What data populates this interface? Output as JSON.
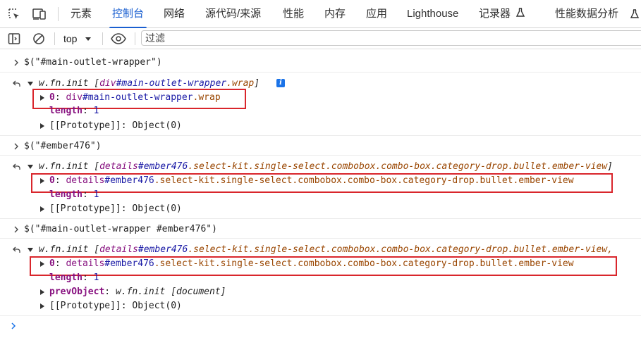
{
  "tabs": [
    {
      "label": "元素"
    },
    {
      "label": "控制台"
    },
    {
      "label": "网络"
    },
    {
      "label": "源代码/来源"
    },
    {
      "label": "性能"
    },
    {
      "label": "内存"
    },
    {
      "label": "应用"
    },
    {
      "label": "Lighthouse"
    },
    {
      "label": "记录器"
    },
    {
      "label": "性能数据分析"
    }
  ],
  "active_tab": "控制台",
  "toolbar": {
    "context": "top",
    "filter_placeholder": "过滤"
  },
  "console": {
    "cmd1": {
      "input": "$(\"#main-outlet-wrapper\")",
      "result_head_a": "w.fn.init [",
      "result_head_tag": "div",
      "result_head_id": "#main-outlet-wrapper",
      "result_head_cls": ".wrap",
      "result_head_b": "]",
      "info_badge": "i",
      "item0_key": "0",
      "item0_sep": ": ",
      "item0_tag": "div",
      "item0_id": "#main-outlet-wrapper",
      "item0_cls": ".wrap",
      "length_key": "length",
      "length_val": "1",
      "proto_key": "[[Prototype]]",
      "proto_val": "Object(0)"
    },
    "cmd2": {
      "input": "$(\"#ember476\")",
      "result_head_a": "w.fn.init [",
      "result_head_tag": "details",
      "result_head_id": "#ember476",
      "result_head_cls": ".select-kit.single-select.combobox.combo-box.category-drop.bullet.ember-view",
      "result_head_b": "]",
      "item0_key": "0",
      "item0_sep": ": ",
      "item0_tag": "details",
      "item0_id": "#ember476",
      "item0_cls": ".select-kit.single-select.combobox.combo-box.category-drop.bullet.ember-view",
      "length_key": "length",
      "length_val": "1",
      "proto_key": "[[Prototype]]",
      "proto_val": "Object(0)"
    },
    "cmd3": {
      "input": "$(\"#main-outlet-wrapper #ember476\")",
      "result_head_a": "w.fn.init [",
      "result_head_tag": "details",
      "result_head_id": "#ember476",
      "result_head_cls": ".select-kit.single-select.combobox.combo-box.category-drop.bullet.ember-view,",
      "item0_key": "0",
      "item0_sep": ": ",
      "item0_tag": "details",
      "item0_id": "#ember476",
      "item0_cls": ".select-kit.single-select.combobox.combo-box.category-drop.bullet.ember-view",
      "length_key": "length",
      "length_val": "1",
      "prev_key": "prevObject",
      "prev_val": "w.fn.init [document]",
      "proto_key": "[[Prototype]]",
      "proto_val": "Object(0)"
    }
  },
  "colors": {
    "accent": "#1a5fd0",
    "highlight_box": "#d9262c",
    "property_key": "#881280",
    "id_selector": "#1a1aa6",
    "class_selector": "#994500"
  }
}
